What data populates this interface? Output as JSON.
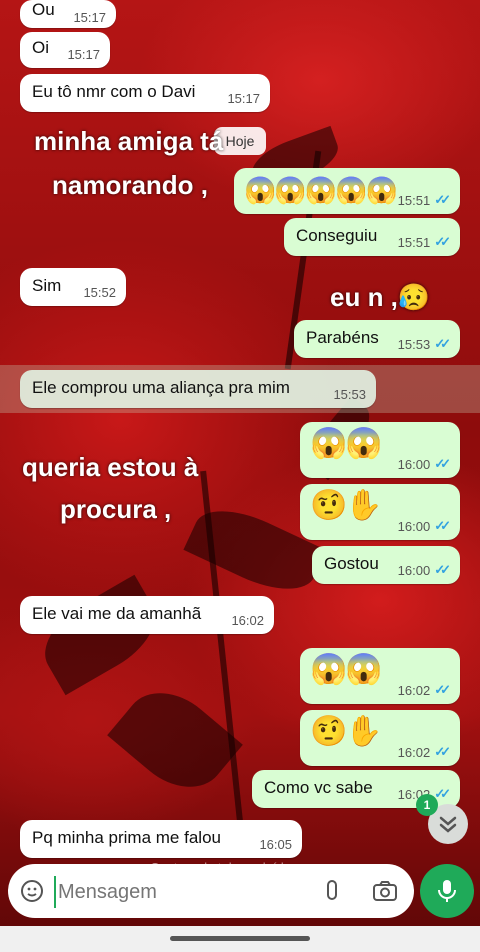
{
  "messages": [
    {
      "text": "Ou",
      "time": "15:17",
      "dir": "in"
    },
    {
      "text": "Oi",
      "time": "15:17",
      "dir": "in"
    },
    {
      "text": "Eu tô nmr com o Davi",
      "time": "15:17",
      "dir": "in"
    },
    {
      "emoji": "😱😱😱😱😱",
      "time": "15:51",
      "dir": "out"
    },
    {
      "text": "Conseguiu",
      "time": "15:51",
      "dir": "out"
    },
    {
      "text": "Sim",
      "time": "15:52",
      "dir": "in"
    },
    {
      "text": "Parabéns",
      "time": "15:53",
      "dir": "out"
    },
    {
      "text": "Ele comprou uma aliança pra mim",
      "time": "15:53",
      "dir": "in"
    },
    {
      "emoji": "😱😱",
      "time": "16:00",
      "dir": "out"
    },
    {
      "emoji": "🤨✋",
      "time": "16:00",
      "dir": "out"
    },
    {
      "text": "Gostou",
      "time": "16:00",
      "dir": "out"
    },
    {
      "text": "Ele vai me da amanhã",
      "time": "16:02",
      "dir": "in"
    },
    {
      "emoji": "😱😱",
      "time": "16:02",
      "dir": "out"
    },
    {
      "emoji": "🤨✋",
      "time": "16:02",
      "dir": "out"
    },
    {
      "text": "Como vc sabe",
      "time": "16:02",
      "dir": "out"
    },
    {
      "text": "Pq minha prima me falou",
      "time": "16:05",
      "dir": "in"
    }
  ],
  "date_chip": "Hoje",
  "overlays": {
    "line1": "minha amiga tá",
    "line2": "namorando ,",
    "line3": "eu n ,😥",
    "line4": "queria estou à",
    "line5": "procura ,"
  },
  "input": {
    "placeholder": "Mensagem"
  },
  "scroll_badge": "1",
  "caption": "Captura de tela excluída",
  "colors": {
    "outgoing": "#d9fdd3",
    "incoming": "#ffffff",
    "accent": "#1faa59",
    "read_ticks": "#34a3e0"
  },
  "icons": [
    "sticker-icon",
    "attach-icon",
    "camera-icon",
    "mic-icon",
    "chevron-down-icon"
  ]
}
